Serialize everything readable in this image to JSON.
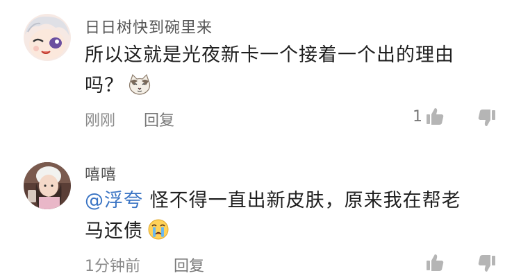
{
  "comments": [
    {
      "username": "日日树快到碗里来",
      "text_line1": "所以这就是光夜新卡一个接着一个出的理由",
      "text_line2": "吗？",
      "emoji": "cat-face-emoji",
      "time": "刚刚",
      "reply_label": "回复",
      "like_count": "1"
    },
    {
      "username": "嘻嘻",
      "mention": "@浮夸",
      "text_line1": " 怪不得一直出新皮肤，原来我在帮老",
      "text_line2": "马还债",
      "emoji": "crying-face-emoji",
      "time": "1分钟前",
      "reply_label": "回复",
      "like_count": ""
    }
  ],
  "colors": {
    "mention": "#3a74c4",
    "meta": "#8a8a8a",
    "icon": "#b5b5b5"
  }
}
